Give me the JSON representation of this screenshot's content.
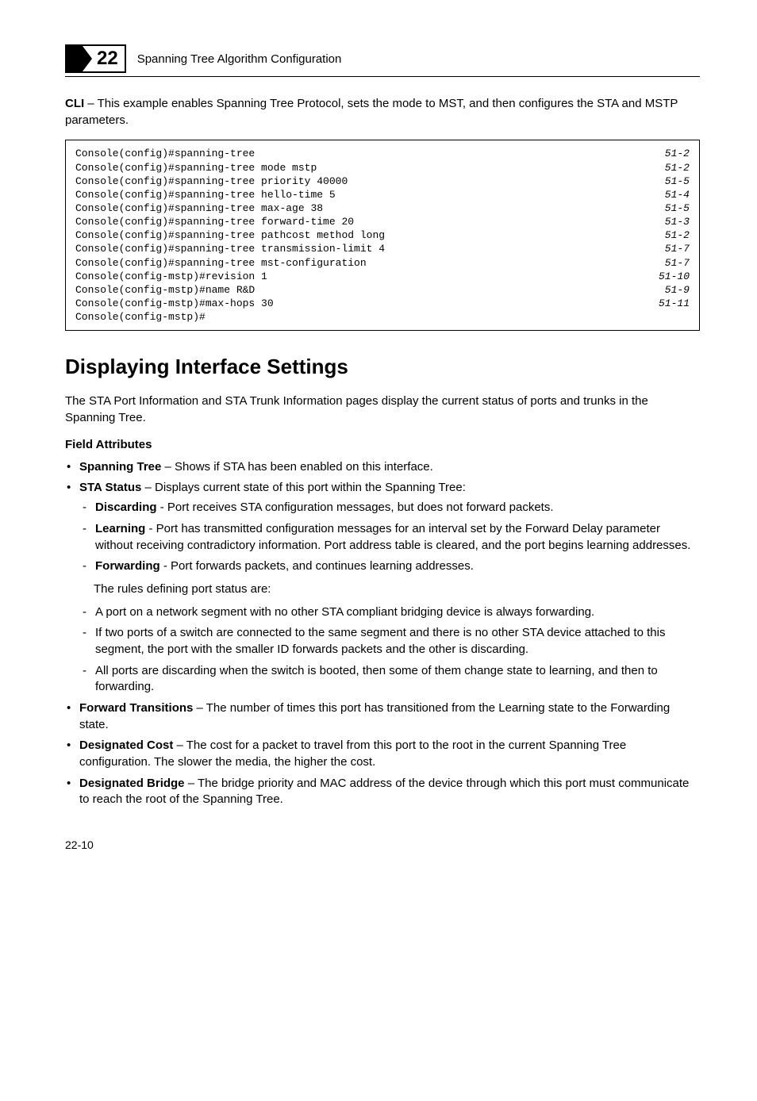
{
  "header": {
    "chapter_number": "22",
    "chapter_title": "Spanning Tree Algorithm Configuration"
  },
  "intro_cli": {
    "label": "CLI",
    "text": " – This example enables Spanning Tree Protocol, sets the mode to MST, and then configures the STA and MSTP parameters."
  },
  "code_lines": [
    {
      "cmd": "Console(config)#spanning-tree",
      "ref": "51-2"
    },
    {
      "cmd": "Console(config)#spanning-tree mode mstp",
      "ref": "51-2"
    },
    {
      "cmd": "Console(config)#spanning-tree priority 40000",
      "ref": "51-5"
    },
    {
      "cmd": "Console(config)#spanning-tree hello-time 5",
      "ref": "51-4"
    },
    {
      "cmd": "Console(config)#spanning-tree max-age 38",
      "ref": "51-5"
    },
    {
      "cmd": "Console(config)#spanning-tree forward-time 20",
      "ref": "51-3"
    },
    {
      "cmd": "Console(config)#spanning-tree pathcost method long",
      "ref": "51-2"
    },
    {
      "cmd": "Console(config)#spanning-tree transmission-limit 4",
      "ref": "51-7"
    },
    {
      "cmd": "Console(config)#spanning-tree mst-configuration",
      "ref": "51-7"
    },
    {
      "cmd": "Console(config-mstp)#revision 1",
      "ref": "51-10"
    },
    {
      "cmd": "Console(config-mstp)#name R&D",
      "ref": "51-9"
    },
    {
      "cmd": "Console(config-mstp)#max-hops 30",
      "ref": "51-11"
    },
    {
      "cmd": "Console(config-mstp)#",
      "ref": ""
    }
  ],
  "section": {
    "heading": "Displaying Interface Settings",
    "intro": "The STA Port Information and STA Trunk Information pages display the current status of ports and trunks in the Spanning Tree.",
    "field_attributes_label": "Field Attributes",
    "bullets": {
      "spanning_tree": {
        "label": "Spanning Tree",
        "text": " – Shows if STA has been enabled on this interface."
      },
      "sta_status": {
        "label": "STA Status",
        "text": " – Displays current state of this port within the Spanning Tree:",
        "sub": {
          "discarding": {
            "label": "Discarding",
            "text": " - Port receives STA configuration messages, but does not forward packets."
          },
          "learning": {
            "label": "Learning",
            "text": " - Port has transmitted configuration messages for an interval set by the Forward Delay parameter without receiving contradictory information. Port address table is cleared, and the port begins learning addresses."
          },
          "forwarding": {
            "label": "Forwarding",
            "text": " - Port forwards packets, and continues learning addresses."
          }
        },
        "rules_intro": "The rules defining port status are:",
        "rules": [
          "A port on a network segment with no other STA compliant bridging device is always forwarding.",
          "If two ports of a switch are connected to the same segment and there is no other STA device attached to this segment, the port with the smaller ID forwards packets and the other is discarding.",
          "All ports are discarding when the switch is booted, then some of them change state to learning, and then to forwarding."
        ]
      },
      "forward_transitions": {
        "label": "Forward Transitions",
        "text": " – The number of times this port has transitioned from the Learning state to the Forwarding state."
      },
      "designated_cost": {
        "label": "Designated Cost",
        "text": " – The cost for a packet to travel from this port to the root in the current Spanning Tree configuration. The slower the media, the higher the cost."
      },
      "designated_bridge": {
        "label": "Designated Bridge",
        "text": " – The bridge priority and MAC address of the device through which this port must communicate to reach the root of the Spanning Tree."
      }
    }
  },
  "footer": {
    "page_number": "22-10"
  }
}
